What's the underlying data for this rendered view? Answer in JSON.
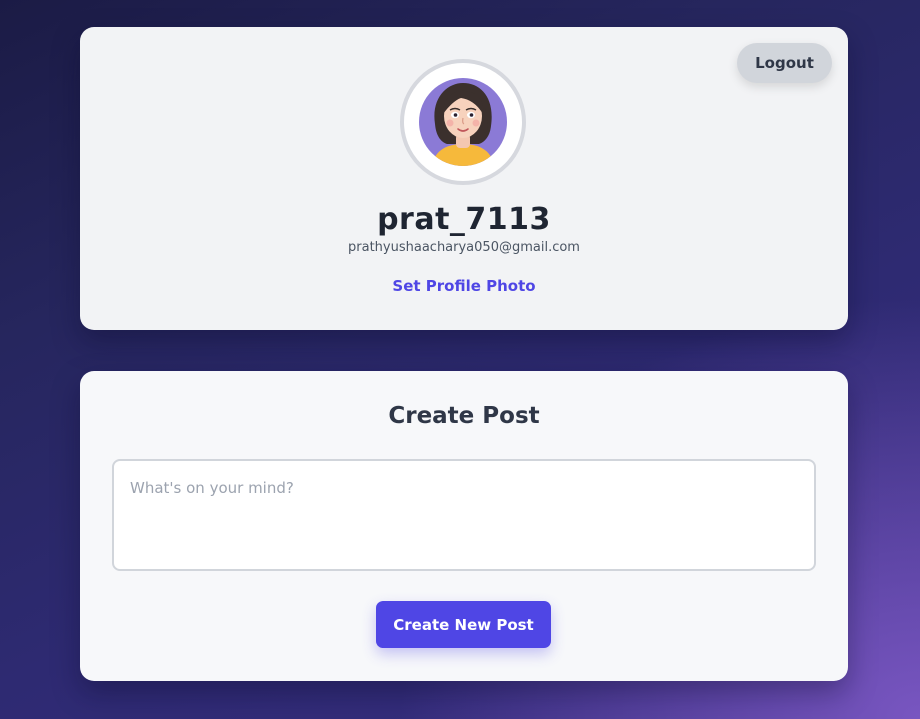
{
  "profile": {
    "logout_label": "Logout",
    "avatar_icon": "woman-avatar-illustration",
    "username": "prat_7113",
    "email": "prathyushaacharya050@gmail.com",
    "set_photo_label": "Set Profile Photo"
  },
  "create_post": {
    "title": "Create Post",
    "textarea_value": "",
    "textarea_placeholder": "What's on your mind?",
    "button_label": "Create New Post"
  },
  "colors": {
    "accent": "#4f46e5",
    "card_background": "#f2f3f5",
    "page_background": "#2a2766",
    "logout_background": "#d1d5db"
  }
}
